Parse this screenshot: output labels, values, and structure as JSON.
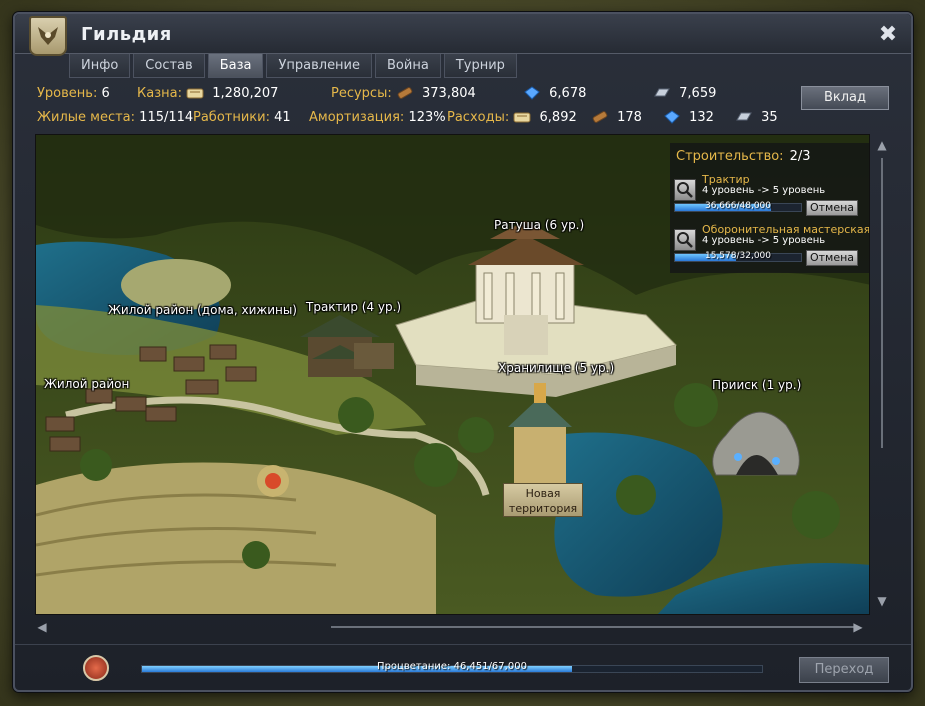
{
  "window": {
    "title": "Гильдия",
    "close_icon": "close-icon"
  },
  "tabs": [
    {
      "label": "Инфо"
    },
    {
      "label": "Состав"
    },
    {
      "label": "База",
      "active": true
    },
    {
      "label": "Управление"
    },
    {
      "label": "Война"
    },
    {
      "label": "Турнир"
    }
  ],
  "stats": {
    "level": {
      "label": "Уровень:",
      "value": "6"
    },
    "treasury": {
      "label": "Казна:",
      "value": "1,280,207",
      "icon": "scroll-icon"
    },
    "resources": {
      "label": "Ресурсы:",
      "wood": "373,804",
      "crystal": "6,678",
      "metal": "7,659"
    },
    "housing": {
      "label": "Жилые места:",
      "value": "115/114"
    },
    "workers": {
      "label": "Работники:",
      "value": "41"
    },
    "depreciation": {
      "label": "Амортизация:",
      "value": "123%"
    },
    "expenses": {
      "label": "Расходы:",
      "gold": "6,892",
      "wood": "178",
      "crystal": "132",
      "metal": "35"
    },
    "deposit_label": "Вклад"
  },
  "map": {
    "labels": {
      "town_hall": "Ратуша (6 ур.)",
      "residential_huts": "Жилой район (дома, хижины)",
      "tavern": "Трактир (4 ур.)",
      "residential": "Жилой район",
      "storage": "Хранилище (5 ур.)",
      "mine": "Прииск (1 ур.)",
      "new_territory_line1": "Новая",
      "new_territory_line2": "территория"
    }
  },
  "construction": {
    "title": "Строительство:",
    "count": "2/3",
    "items": [
      {
        "name": "Трактир",
        "levels": "4 уровень -> 5 уровень",
        "progress_text": "36,666/48,000",
        "progress": 0.764,
        "cancel": "Отмена"
      },
      {
        "name": "Оборонительная мастерская",
        "levels": "4 уровень -> 5 уровень",
        "progress_text": "15,578/32,000",
        "progress": 0.487,
        "cancel": "Отмена"
      }
    ]
  },
  "footer": {
    "prosperity_text": "Процветание: 46,451/67,000",
    "prosperity": 0.693,
    "go_label": "Переход"
  },
  "colors": {
    "label_gold": "#e6b84a",
    "bar_blue": "#2a78d8",
    "window_bg": "#1d2129"
  }
}
